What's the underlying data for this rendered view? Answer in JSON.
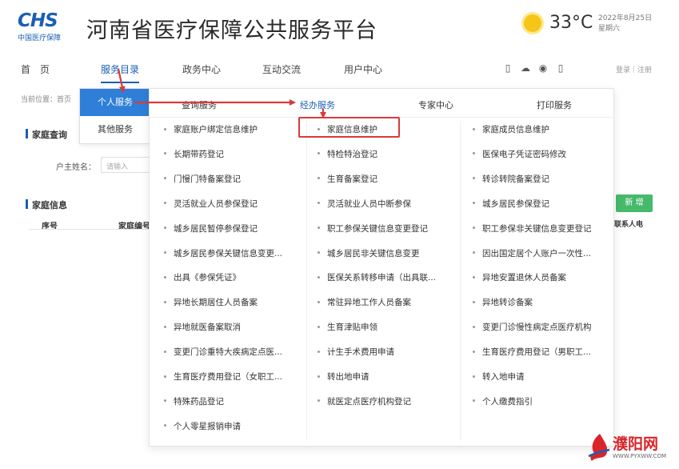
{
  "header": {
    "logo_mark": "CHS",
    "logo_sub": "中国医疗保障",
    "site_title": "河南省医疗保障公共服务平台",
    "temperature": "33°C",
    "date": "2022年8月25日",
    "weekday": "星期六"
  },
  "nav": {
    "items": [
      {
        "label": "首　页"
      },
      {
        "label": "服务目录"
      },
      {
        "label": "政务中心"
      },
      {
        "label": "互动交流"
      },
      {
        "label": "用户中心"
      }
    ],
    "icons": [
      "mobile-icon",
      "wechat-icon",
      "accessibility-icon",
      "phone-icon"
    ],
    "login_text": "登录｜注册"
  },
  "page": {
    "breadcrumb": "当前位置：首页",
    "section1_title": "家庭查询",
    "owner_label": "户主姓名：",
    "owner_placeholder": "请输入",
    "section2_title": "家庭信息",
    "col_seq": "序号",
    "col_family_no": "家庭编号",
    "add_button": "新 增",
    "right_col": "联系人电"
  },
  "left_menu": {
    "items": [
      {
        "label": "个人服务"
      },
      {
        "label": "其他服务"
      }
    ]
  },
  "dropdown": {
    "tabs": [
      {
        "label": "查询服务"
      },
      {
        "label": "经办服务"
      },
      {
        "label": "专家中心"
      },
      {
        "label": "打印服务"
      }
    ],
    "col1": [
      "家庭账户绑定信息维护",
      "长期带药登记",
      "门慢门特备案登记",
      "灵活就业人员参保登记",
      "城乡居民暂停参保登记",
      "城乡居民参保关键信息变更...",
      "出具《参保凭证》",
      "异地长期居住人员备案",
      "异地就医备案取消",
      "变更门诊重特大疾病定点医...",
      "生育医疗费用登记（女职工...",
      "特殊药品登记",
      "个人零星报销申请"
    ],
    "col2": [
      "家庭信息维护",
      "特检特治登记",
      "生育备案登记",
      "灵活就业人员中断参保",
      "职工参保关键信息变更登记",
      "城乡居民非关键信息变更",
      "医保关系转移申请（出具联...",
      "常驻异地工作人员备案",
      "生育津贴申领",
      "计生手术费用申请",
      "转出地申请",
      "就医定点医疗机构登记"
    ],
    "col3": [
      "家庭成员信息维护",
      "医保电子凭证密码修改",
      "转诊转院备案登记",
      "城乡居民参保登记",
      "职工参保非关键信息变更登记",
      "因出国定居个人账户一次性...",
      "异地安置退休人员备案",
      "异地转诊备案",
      "变更门诊慢性病定点医疗机构",
      "生育医疗费用登记（男职工...",
      "转入地申请",
      "个人缴费指引"
    ]
  },
  "watermark": {
    "name": "濮阳网",
    "url": "WWW.PYXWW.COM"
  },
  "colors": {
    "brand_blue": "#1a5fb4",
    "menu_active": "#2f7fd8",
    "annotation_red": "#d93a3a",
    "green": "#46b96a"
  }
}
